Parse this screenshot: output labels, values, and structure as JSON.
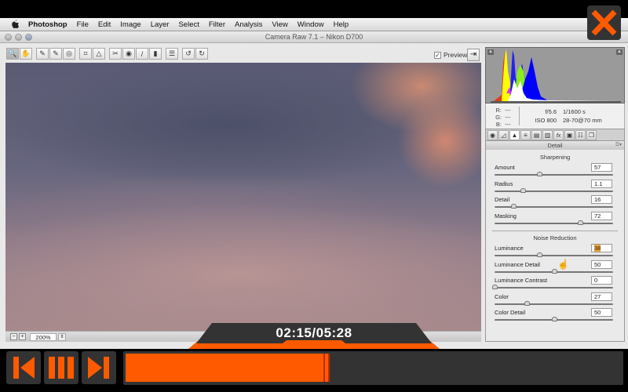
{
  "menubar": {
    "apple_icon": "",
    "items": [
      "Photoshop",
      "File",
      "Edit",
      "Image",
      "Layer",
      "Select",
      "Filter",
      "Analysis",
      "View",
      "Window",
      "Help"
    ]
  },
  "window": {
    "title": "Camera Raw 7.1  –  Nikon D700"
  },
  "toolbar": {
    "tools": [
      {
        "name": "zoom-tool-icon",
        "glyph": "🔍",
        "selected": true
      },
      {
        "name": "hand-tool-icon",
        "glyph": "✋"
      },
      {
        "name": "white-balance-tool-icon",
        "glyph": "✎"
      },
      {
        "name": "color-sampler-tool-icon",
        "glyph": "✎"
      },
      {
        "name": "targeted-adjustment-tool-icon",
        "glyph": "◎"
      },
      {
        "name": "crop-tool-icon",
        "glyph": "⌗"
      },
      {
        "name": "straighten-tool-icon",
        "glyph": "△"
      },
      {
        "name": "spot-removal-tool-icon",
        "glyph": "✂"
      },
      {
        "name": "red-eye-tool-icon",
        "glyph": "◉"
      },
      {
        "name": "adjustment-brush-icon",
        "glyph": "/"
      },
      {
        "name": "graduated-filter-icon",
        "glyph": "▮"
      },
      {
        "name": "preferences-icon",
        "glyph": "☰"
      },
      {
        "name": "rotate-left-icon",
        "glyph": "↺"
      },
      {
        "name": "rotate-right-icon",
        "glyph": "↻"
      }
    ],
    "preview_label": "Preview",
    "preview_checked": true
  },
  "zoom": {
    "minus": "−",
    "plus": "+",
    "value": "200%",
    "dropdown": "⇕"
  },
  "info": {
    "r_label": "R:",
    "r_value": "---",
    "g_label": "G:",
    "g_value": "---",
    "b_label": "B:",
    "b_value": "---",
    "aperture": "f/5.6",
    "shutter": "1/1600 s",
    "iso": "ISO 800",
    "lens": "28-70@70 mm"
  },
  "panel_tabs": [
    {
      "name": "basic-tab-icon",
      "glyph": "◉"
    },
    {
      "name": "tone-curve-tab-icon",
      "glyph": "◿"
    },
    {
      "name": "detail-tab-icon",
      "glyph": "▲",
      "active": true
    },
    {
      "name": "hsl-tab-icon",
      "glyph": "≡"
    },
    {
      "name": "split-toning-tab-icon",
      "glyph": "▤"
    },
    {
      "name": "lens-corrections-tab-icon",
      "glyph": "▥"
    },
    {
      "name": "effects-tab-icon",
      "glyph": "fx"
    },
    {
      "name": "camera-calibration-tab-icon",
      "glyph": "▣"
    },
    {
      "name": "presets-tab-icon",
      "glyph": "☷"
    },
    {
      "name": "snapshots-tab-icon",
      "glyph": "❐"
    }
  ],
  "detail": {
    "header": "Detail",
    "sharpening": {
      "title": "Sharpening",
      "rows": [
        {
          "label": "Amount",
          "value": "57",
          "position": 0.38
        },
        {
          "label": "Radius",
          "value": "1.1",
          "position": 0.24
        },
        {
          "label": "Detail",
          "value": "16",
          "position": 0.16
        },
        {
          "label": "Masking",
          "value": "72",
          "position": 0.72
        }
      ]
    },
    "noise_reduction": {
      "title": "Noise Reduction",
      "rows": [
        {
          "label": "Luminance",
          "value": "38",
          "position": 0.38,
          "highlighted": true
        },
        {
          "label": "Luminance Detail",
          "value": "50",
          "position": 0.5
        },
        {
          "label": "Luminance Contrast",
          "value": "0",
          "position": 0
        },
        {
          "label": "Color",
          "value": "27",
          "position": 0.27
        },
        {
          "label": "Color Detail",
          "value": "50",
          "position": 0.5
        }
      ]
    }
  },
  "player": {
    "time": "02:15/05:28",
    "progress": 0.41,
    "accent": "#ff5a00",
    "dark": "#333333"
  }
}
